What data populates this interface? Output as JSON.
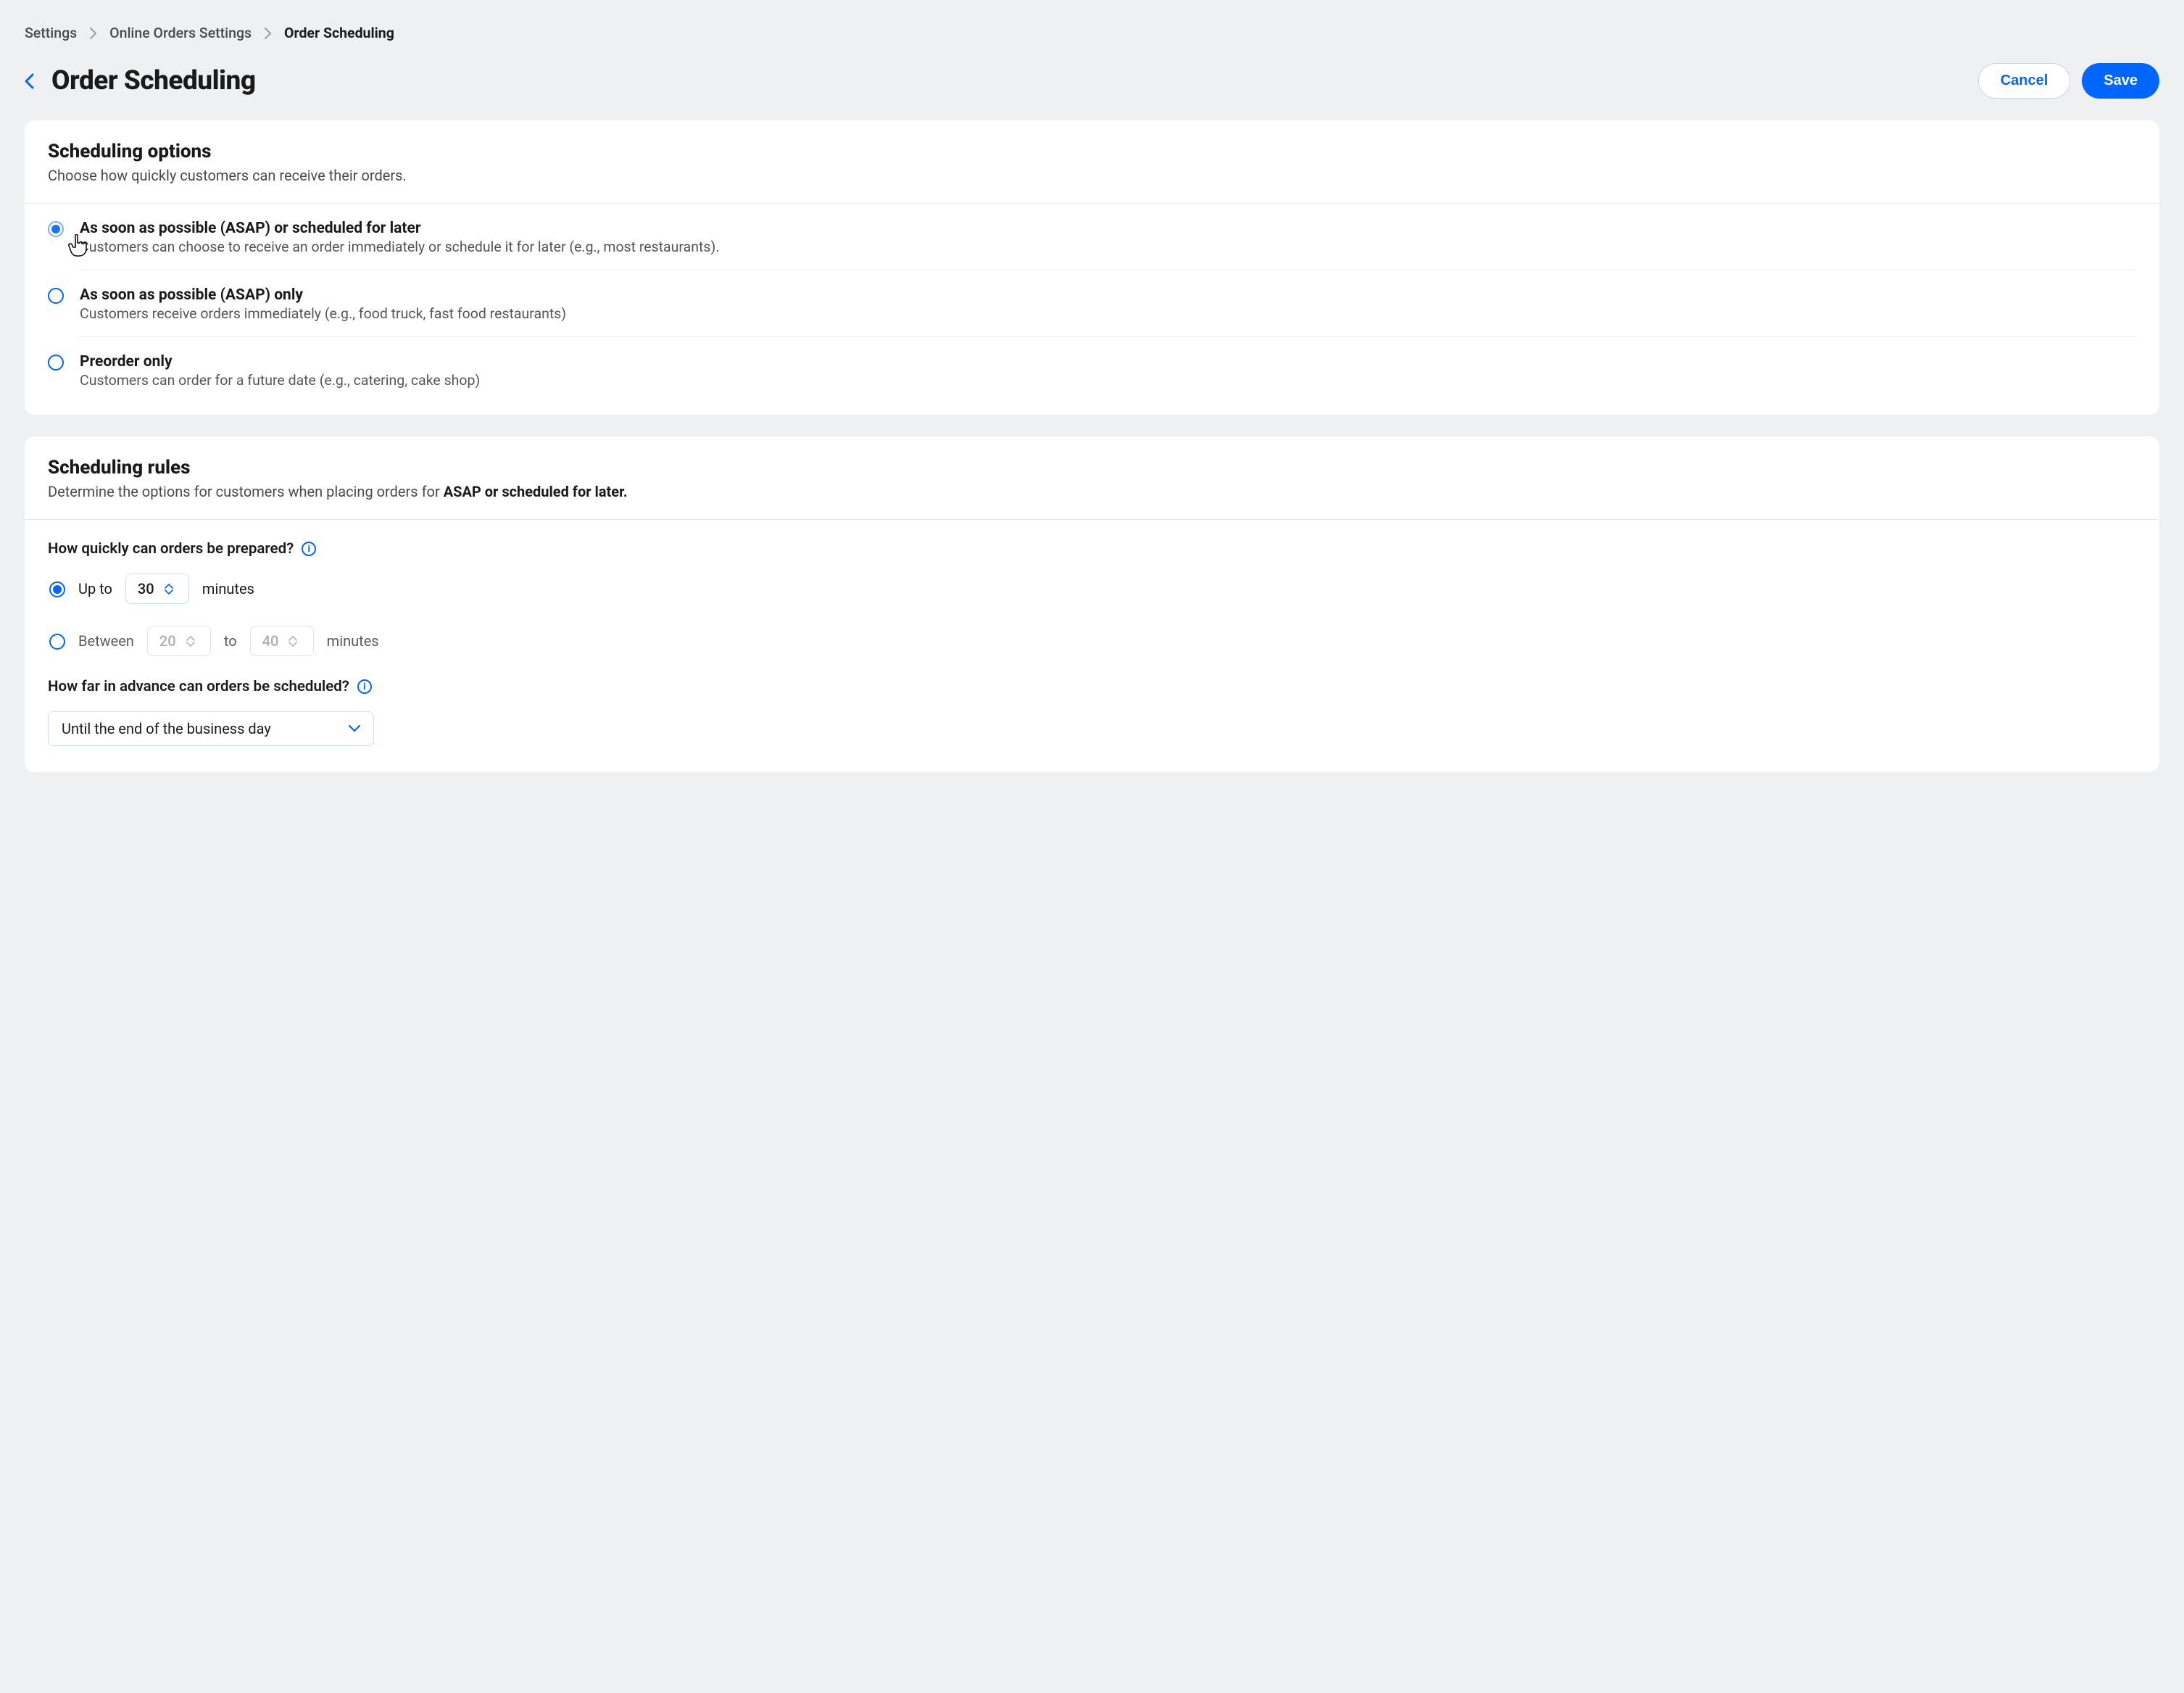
{
  "breadcrumb": {
    "a": "Settings",
    "b": "Online Orders Settings",
    "c": "Order Scheduling"
  },
  "title": "Order Scheduling",
  "buttons": {
    "cancel": "Cancel",
    "save": "Save"
  },
  "card1": {
    "title": "Scheduling options",
    "sub": "Choose how quickly customers can receive their orders.",
    "opts": [
      {
        "t": "As soon as possible (ASAP) or scheduled for later",
        "d": "Customers can choose to receive an order immediately or schedule it for later (e.g., most restaurants).",
        "sel": true
      },
      {
        "t": "As soon as possible (ASAP)  only",
        "d": "Customers receive orders immediately (e.g., food truck, fast food restaurants)",
        "sel": false
      },
      {
        "t": "Preorder only",
        "d": "Customers can order for a future date (e.g., catering, cake shop)",
        "sel": false
      }
    ]
  },
  "card2": {
    "title": "Scheduling rules",
    "sub_pre": "Determine the options for customers when placing orders for ",
    "sub_b": "ASAP or scheduled for later.",
    "q1": "How quickly can orders be prepared?",
    "r1": {
      "pre": "Up to",
      "val": "30",
      "post": "minutes",
      "sel": true
    },
    "r2": {
      "pre": "Between",
      "v1": "20",
      "mid": "to",
      "v2": "40",
      "post": "minutes",
      "sel": false
    },
    "q2": "How far in advance can orders be scheduled?",
    "select": "Until the end of the business day"
  }
}
